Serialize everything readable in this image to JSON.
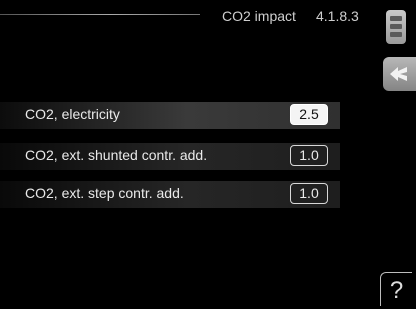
{
  "header": {
    "title": "CO2 impact",
    "menu_number": "4.1.8.3"
  },
  "icons": {
    "scroll": "scroll-indicator-icon",
    "back": "back-arrow-icon",
    "help": "help-icon",
    "help_glyph": "?"
  },
  "settings": [
    {
      "label": "CO2, electricity",
      "value": "2.5",
      "selected": true
    },
    {
      "label": "CO2, ext. shunted contr. add.",
      "value": "1.0",
      "selected": false
    },
    {
      "label": "CO2, ext. step contr. add.",
      "value": "1.0",
      "selected": false
    }
  ]
}
